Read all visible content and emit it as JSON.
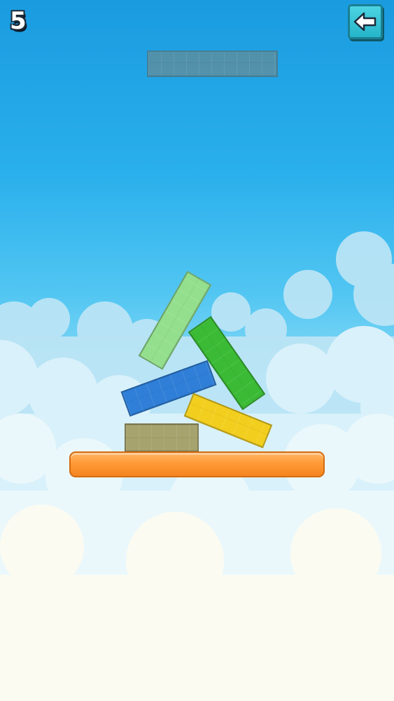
{
  "hud": {
    "score": "5",
    "back_icon": "arrow-left-icon"
  },
  "colors": {
    "ghost_block": "#5c8fa0",
    "base_block": "#a7a36e",
    "blue_block": "#2f7fd8",
    "light_green_block": "#94df8e",
    "green_block": "#3bbb35",
    "yellow_block": "#f2cf1f",
    "platform": "#ff9a36",
    "back_button": "#23b2c7"
  }
}
